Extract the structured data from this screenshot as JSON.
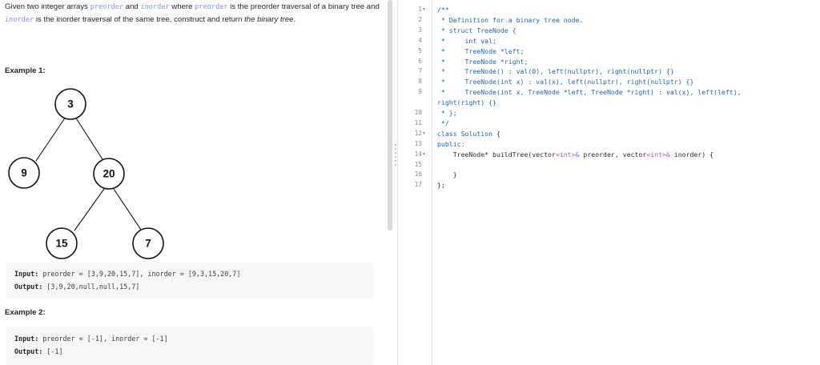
{
  "description": {
    "seg1": "Given two integer arrays ",
    "preorder_code": "preorder",
    "and": " and ",
    "inorder_code": "inorder",
    "where": " where ",
    "preorder_code_2": "preorder",
    "seg2": " is the preorder traversal of a binary tree and ",
    "inorder_code_2": "inorder",
    "seg3": " is the inorder traversal of the same tree, construct and return ",
    "the_binary_tree": "the binary tree",
    "period": "."
  },
  "example1": {
    "title": "Example 1:",
    "input_label": "Input:",
    "input_value": " preorder = [3,9,20,15,7], inorder = [9,3,15,20,7]",
    "output_label": "Output:",
    "output_value": " [3,9,20,null,null,15,7]",
    "tree_nodes": [
      "3",
      "9",
      "20",
      "15",
      "7"
    ]
  },
  "example2": {
    "title": "Example 2:",
    "input_label": "Input:",
    "input_value": " preorder = [-1], inorder = [-1]",
    "output_label": "Output:",
    "output_value": " [-1]"
  },
  "editor": {
    "line_numbers": [
      "1",
      "2",
      "3",
      "4",
      "5",
      "6",
      "7",
      "8",
      "9",
      "",
      "10",
      "11",
      "12",
      "13",
      "14",
      "15",
      "16",
      "17"
    ],
    "lines": [
      "/**",
      " * Definition for a binary tree node.",
      " * struct TreeNode {",
      " *     int val;",
      " *     TreeNode *left;",
      " *     TreeNode *right;",
      " *     TreeNode() : val(0), left(nullptr), right(nullptr) {}",
      " *     TreeNode(int x) : val(x), left(nullptr), right(nullptr) {}",
      " *     TreeNode(int x, TreeNode *left, TreeNode *right) : val(x), left(left),",
      "right(right) {}",
      " * };",
      " */",
      "class Solution {",
      "public:",
      "    TreeNode* buildTree(vector<int>& preorder, vector<int>& inorder) {",
      "",
      "    }",
      "};"
    ]
  },
  "colors": {
    "comment": "#1f63b6",
    "keyword": "#1f63b6",
    "operator": "#a45ad6",
    "inline_code": "#8a96d6"
  }
}
